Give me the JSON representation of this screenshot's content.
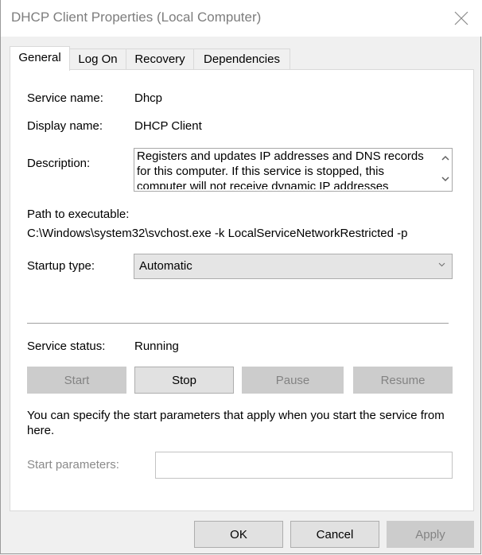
{
  "window": {
    "title": "DHCP Client Properties (Local Computer)"
  },
  "tabs": [
    {
      "label": "General",
      "active": true
    },
    {
      "label": "Log On",
      "active": false
    },
    {
      "label": "Recovery",
      "active": false
    },
    {
      "label": "Dependencies",
      "active": false
    }
  ],
  "general": {
    "service_name_label": "Service name:",
    "service_name_value": "Dhcp",
    "display_name_label": "Display name:",
    "display_name_value": "DHCP Client",
    "description_label": "Description:",
    "description_value": "Registers and updates IP addresses and DNS records for this computer. If this service is stopped, this computer will not receive dynamic IP addresses",
    "path_label": "Path to executable:",
    "path_value": "C:\\Windows\\system32\\svchost.exe -k LocalServiceNetworkRestricted -p",
    "startup_type_label": "Startup type:",
    "startup_type_value": "Automatic",
    "service_status_label": "Service status:",
    "service_status_value": "Running",
    "buttons": {
      "start": "Start",
      "stop": "Stop",
      "pause": "Pause",
      "resume": "Resume"
    },
    "help_text": "You can specify the start parameters that apply when you start the service from here.",
    "start_params_label": "Start parameters:",
    "start_params_value": ""
  },
  "footer": {
    "ok": "OK",
    "cancel": "Cancel",
    "apply": "Apply"
  },
  "icons": {
    "close": "close-icon",
    "scroll_up": "chevron-up-icon",
    "scroll_down": "chevron-down-icon",
    "combo_arrow": "chevron-down-icon"
  },
  "colors": {
    "window_bg": "#f0f0f0",
    "panel_bg": "#ffffff",
    "disabled_button": "#cccccc",
    "enabled_button": "#e1e1e1",
    "title_text": "#7d7d7d"
  }
}
